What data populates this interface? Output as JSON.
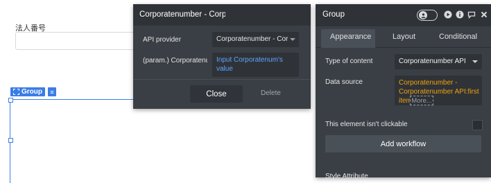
{
  "canvas": {
    "field_label": "法人番号",
    "group_tag_label": "Group"
  },
  "left_panel": {
    "title": "Corporatenumber - Corporatenumber API",
    "api_provider_label": "API provider",
    "api_provider_value": "Corporatenumber - Corporatenumber API",
    "param_label": "(param.) Corporatenumber",
    "param_placeholder": "Input Corporatenum's value",
    "close_label": "Close",
    "delete_label": "Delete"
  },
  "right_panel": {
    "title": "Group",
    "tabs": [
      {
        "label": "Appearance",
        "active": true
      },
      {
        "label": "Layout",
        "active": false
      },
      {
        "label": "Conditional",
        "active": false
      }
    ],
    "type_of_content_label": "Type of content",
    "type_of_content_value": "Corporatenumber API",
    "data_source_label": "Data source",
    "data_source_value": "Corporatenumber - Corporatenumber API:first item",
    "data_source_more": "More...",
    "clickable_label": "This element isn't clickable",
    "add_workflow_label": "Add workflow",
    "style_label": "Style Attribute"
  },
  "colors": {
    "panel_bg": "#3a3f45",
    "panel_header": "#2f3338",
    "accent_blue": "#3b7de6",
    "link_blue": "#5fa3ff",
    "data_orange": "#f0a30a"
  },
  "icons": [
    "dashed-box-icon",
    "stack-icon",
    "user-icon",
    "play-icon",
    "info-icon",
    "comment-icon",
    "close-icon",
    "caret-down-icon"
  ]
}
